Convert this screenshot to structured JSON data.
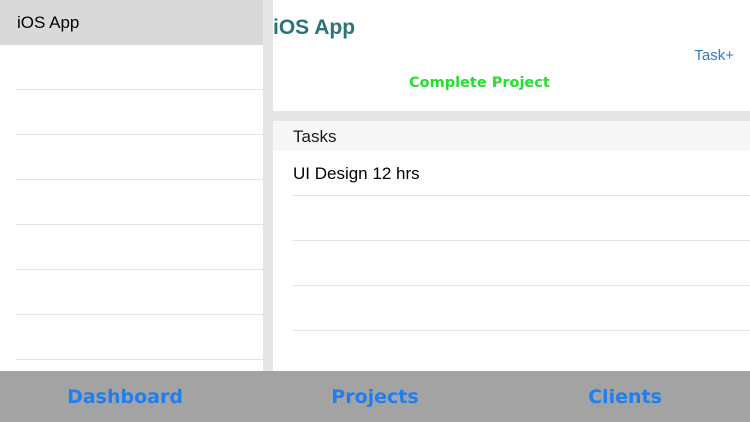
{
  "master": {
    "items": [
      {
        "label": "iOS App",
        "selected": true
      },
      {
        "label": ""
      },
      {
        "label": ""
      },
      {
        "label": ""
      },
      {
        "label": ""
      },
      {
        "label": ""
      },
      {
        "label": ""
      },
      {
        "label": ""
      },
      {
        "label": ""
      }
    ]
  },
  "detail": {
    "title": "iOS App",
    "add_task_label": "Task+",
    "complete_label": "Complete Project",
    "section_header": "Tasks",
    "tasks": [
      {
        "label": "UI Design 12 hrs"
      },
      {
        "label": ""
      },
      {
        "label": ""
      },
      {
        "label": ""
      },
      {
        "label": ""
      }
    ]
  },
  "tabs": [
    {
      "label": "Dashboard"
    },
    {
      "label": "Projects"
    },
    {
      "label": "Clients"
    }
  ],
  "colors": {
    "title": "#2a7478",
    "accent_link": "#2f7ccf",
    "complete": "#22e02b",
    "tab_text": "#1f7ef0",
    "tab_bar": "#a3a3a3",
    "selected_row": "#d9d9d9"
  }
}
